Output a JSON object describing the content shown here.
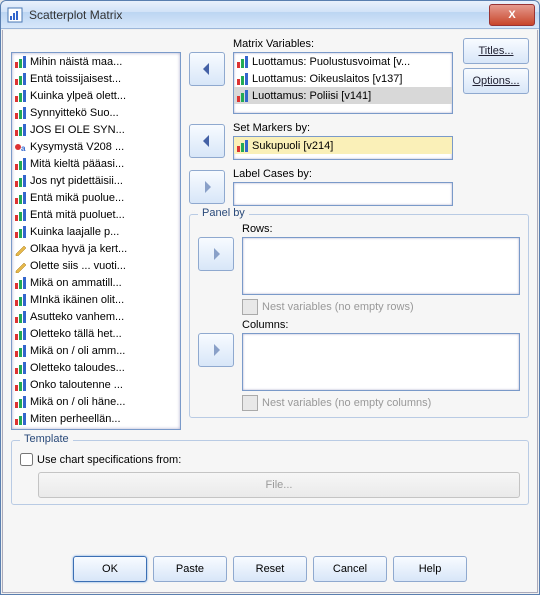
{
  "window": {
    "title": "Scatterplot Matrix",
    "close": "X"
  },
  "labels": {
    "matrix_variables": "Matrix Variables:",
    "set_markers_by": "Set Markers by:",
    "label_cases_by": "Label Cases by:",
    "panel_by": "Panel by",
    "rows": "Rows:",
    "columns": "Columns:",
    "nest_rows": "Nest variables (no empty rows)",
    "nest_cols": "Nest variables (no empty columns)",
    "template": "Template",
    "use_chart_spec": "Use chart specifications from:",
    "file": "File..."
  },
  "side_buttons": {
    "titles": "Titles...",
    "options": "Options..."
  },
  "buttons": {
    "ok": "OK",
    "paste": "Paste",
    "reset": "Reset",
    "cancel": "Cancel",
    "help": "Help"
  },
  "sourceVars": [
    "Mihin näistä maa...",
    "Entä toissijaisest...",
    "Kuinka ylpeä olett...",
    "Synnyittekö Suo...",
    "JOS EI OLE SYN...",
    "Kysymystä V208 ...",
    "Mitä kieltä pääasi...",
    "Jos nyt pidettäisii...",
    "Entä mikä puolue...",
    "Entä mitä puoluet...",
    "Kuinka laajalle p...",
    "Olkaa hyvä ja kert...",
    "Olette siis ... vuoti...",
    "Mikä on ammatill...",
    "MInkä ikäinen olit...",
    "Asutteko vanhem...",
    "Oletteko tällä het...",
    "Mikä on / oli amm...",
    "Oletteko taloudes...",
    "Onko taloutenne ...",
    "Mikä on / oli häne...",
    "Miten perheellän..."
  ],
  "sourceIcons": [
    "bar",
    "bar",
    "bar",
    "bar",
    "bar",
    "str",
    "bar",
    "bar",
    "bar",
    "bar",
    "bar",
    "pen",
    "pen",
    "bar",
    "bar",
    "bar",
    "bar",
    "bar",
    "bar",
    "bar",
    "bar",
    "bar"
  ],
  "matrixVars": [
    "Luottamus: Puolustusvoimat [v...",
    "Luottamus: Oikeuslaitos [v137]",
    "Luottamus: Poliisi [v141]"
  ],
  "markers": [
    "Sukupuoli [v214]"
  ]
}
